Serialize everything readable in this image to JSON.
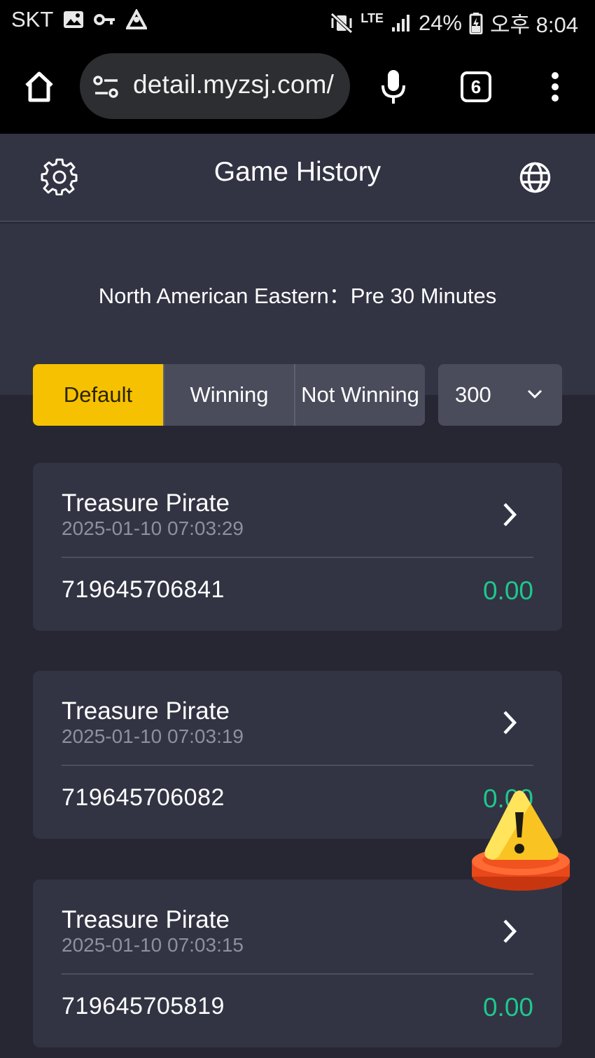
{
  "statusbar": {
    "carrier": "SKT",
    "network": "LTE",
    "battery": "24%",
    "time": "오후 8:04"
  },
  "browser": {
    "url": "detail.myzsj.com/",
    "tab_count": "6"
  },
  "header": {
    "title": "Game History"
  },
  "timezone_label": "North American Eastern：Pre 30 Minutes",
  "filters": {
    "tabs": [
      {
        "label": "Default",
        "active": true
      },
      {
        "label": "Winning",
        "active": false
      },
      {
        "label": "Not Winning",
        "active": false
      }
    ],
    "count_select": "300"
  },
  "records": [
    {
      "game": "Treasure Pirate",
      "time": "2025-01-10 07:03:29",
      "order_id": "719645706841",
      "amount": "0.00"
    },
    {
      "game": "Treasure Pirate",
      "time": "2025-01-10 07:03:19",
      "order_id": "719645706082",
      "amount": "0.00"
    },
    {
      "game": "Treasure Pirate",
      "time": "2025-01-10 07:03:15",
      "order_id": "719645705819",
      "amount": "0.00"
    }
  ],
  "colors": {
    "accent": "#f6c100",
    "win_amount": "#1ec78e",
    "background": "#262733",
    "card": "#323443"
  }
}
